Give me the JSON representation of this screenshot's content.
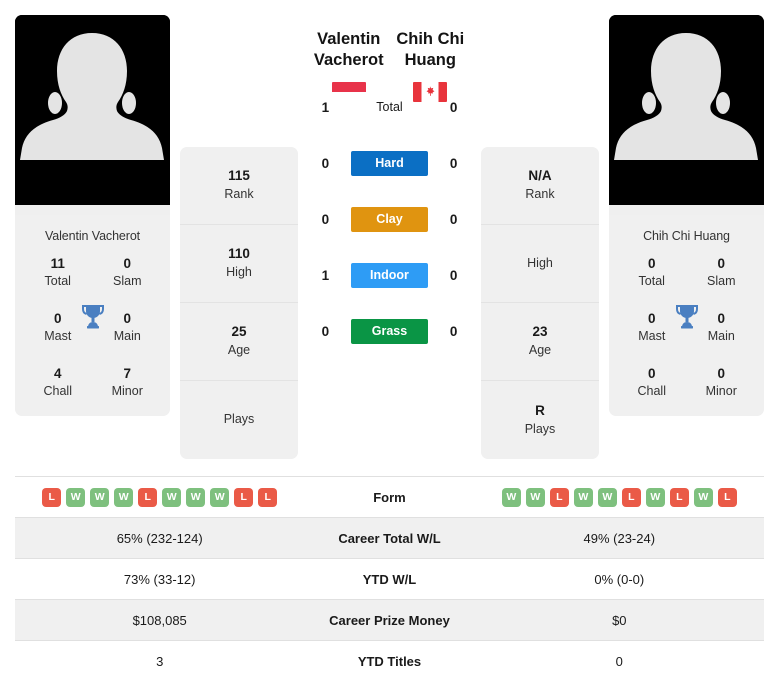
{
  "players": {
    "left": {
      "name": "Valentin Vacherot",
      "name_line1": "Valentin",
      "name_line2": "Vacherot",
      "card_name": "Valentin Vacherot",
      "flag": "monaco-flag",
      "titles": [
        {
          "value": "11",
          "label": "Total"
        },
        {
          "value": "0",
          "label": "Slam"
        },
        {
          "value": "0",
          "label": "Mast"
        },
        {
          "value": "0",
          "label": "Main"
        },
        {
          "value": "4",
          "label": "Chall"
        },
        {
          "value": "7",
          "label": "Minor"
        }
      ],
      "info": [
        {
          "value": "115",
          "label": "Rank"
        },
        {
          "value": "110",
          "label": "High"
        },
        {
          "value": "25",
          "label": "Age"
        },
        {
          "value": "",
          "label": "Plays"
        }
      ],
      "form": [
        "L",
        "W",
        "W",
        "W",
        "L",
        "W",
        "W",
        "W",
        "L",
        "L"
      ],
      "career_total_wl": "65% (232-124)",
      "ytd_wl": "73% (33-12)",
      "career_prize_money": "$108,085",
      "ytd_titles": "3"
    },
    "right": {
      "name": "Chih Chi Huang",
      "name_line1": "Chih Chi",
      "name_line2": "Huang",
      "card_name": "Chih Chi Huang",
      "flag": "canada-flag",
      "titles": [
        {
          "value": "0",
          "label": "Total"
        },
        {
          "value": "0",
          "label": "Slam"
        },
        {
          "value": "0",
          "label": "Mast"
        },
        {
          "value": "0",
          "label": "Main"
        },
        {
          "value": "0",
          "label": "Chall"
        },
        {
          "value": "0",
          "label": "Minor"
        }
      ],
      "info": [
        {
          "value": "N/A",
          "label": "Rank"
        },
        {
          "value": "",
          "label": "High"
        },
        {
          "value": "23",
          "label": "Age"
        },
        {
          "value": "R",
          "label": "Plays"
        }
      ],
      "form": [
        "W",
        "W",
        "L",
        "W",
        "W",
        "L",
        "W",
        "L",
        "W",
        "L"
      ],
      "career_total_wl": "49% (23-24)",
      "ytd_wl": "0% (0-0)",
      "career_prize_money": "$0",
      "ytd_titles": "0"
    }
  },
  "h2h": {
    "rows": [
      {
        "label": "Total",
        "left": "1",
        "right": "0",
        "color": "none"
      },
      {
        "label": "Hard",
        "left": "0",
        "right": "0",
        "color": "#0b6fc4"
      },
      {
        "label": "Clay",
        "left": "0",
        "right": "0",
        "color": "#e09410"
      },
      {
        "label": "Indoor",
        "left": "1",
        "right": "0",
        "color": "#2e9cf5"
      },
      {
        "label": "Grass",
        "left": "0",
        "right": "0",
        "color": "#0a9545"
      }
    ]
  },
  "stats_table": {
    "rows": [
      {
        "label": "Form",
        "type": "form",
        "left": "",
        "right": ""
      },
      {
        "label": "Career Total W/L",
        "type": "text",
        "left": "65% (232-124)",
        "right": "49% (23-24)"
      },
      {
        "label": "YTD W/L",
        "type": "text",
        "left": "73% (33-12)",
        "right": "0% (0-0)"
      },
      {
        "label": "Career Prize Money",
        "type": "text",
        "left": "$108,085",
        "right": "$0"
      },
      {
        "label": "YTD Titles",
        "type": "text",
        "left": "3",
        "right": "0"
      }
    ]
  },
  "colors": {
    "hard": "#0b6fc4",
    "clay": "#e09410",
    "indoor": "#2e9cf5",
    "grass": "#0a9545",
    "win_badge": "#7ec07e",
    "loss_badge": "#ea5a47",
    "trophy": "#4a7fc1",
    "panel_bg": "#f0f0f0",
    "monaco_red": "#e8334a",
    "canada_red": "#e8343c"
  }
}
